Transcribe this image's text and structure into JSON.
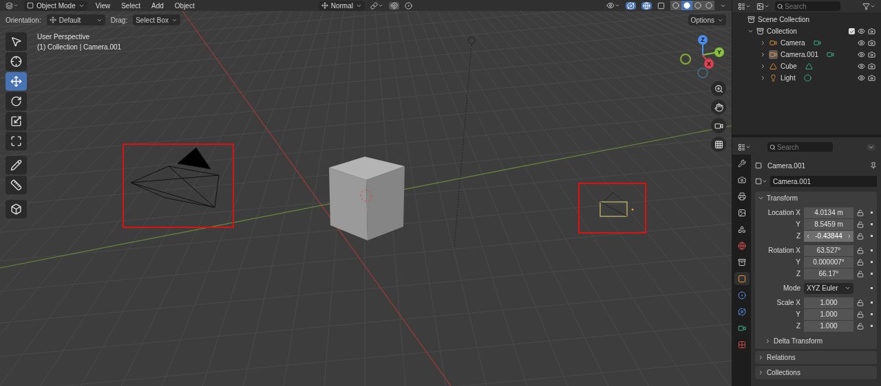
{
  "header": {
    "mode": "Object Mode",
    "menus": [
      "View",
      "Select",
      "Add",
      "Object"
    ],
    "orientation": "Normal",
    "shading": [
      {
        "kind": "wireframe",
        "selected": false
      },
      {
        "kind": "solid",
        "selected": true
      },
      {
        "kind": "material",
        "selected": false
      },
      {
        "kind": "rendered",
        "selected": false
      }
    ]
  },
  "tool_settings": {
    "orientation_label": "Orientation:",
    "orientation": "Default",
    "drag_label": "Drag:",
    "drag": "Select Box",
    "options": "Options"
  },
  "viewport": {
    "view_name": "User Perspective",
    "context": "(1) Collection | Camera.001",
    "gizmo_axes": [
      "Z",
      "Y",
      "X"
    ]
  },
  "toolbar": [
    {
      "kind": "select_box",
      "selected": false
    },
    {
      "kind": "cursor",
      "selected": false
    },
    {
      "kind": "move",
      "selected": true
    },
    {
      "kind": "rotate",
      "selected": false
    },
    {
      "kind": "scale",
      "selected": false
    },
    {
      "kind": "transform",
      "selected": false
    },
    {
      "kind": "annotate",
      "selected": false
    },
    {
      "kind": "measure",
      "selected": false
    },
    {
      "kind": "add_cube",
      "selected": false
    }
  ],
  "outliner": {
    "search_placeholder": "Search",
    "root": "Scene Collection",
    "collection": {
      "name": "Collection",
      "checked": true,
      "expanded": true,
      "children": [
        {
          "name": "Camera",
          "kind": "camera",
          "selected": false
        },
        {
          "name": "Camera.001",
          "kind": "camera",
          "selected": true
        },
        {
          "name": "Cube",
          "kind": "mesh",
          "selected": false
        },
        {
          "name": "Light",
          "kind": "light",
          "selected": false
        }
      ]
    }
  },
  "properties": {
    "search_placeholder": "Search",
    "tabs": [
      {
        "kind": "tool",
        "selected": false
      },
      {
        "kind": "render",
        "selected": false
      },
      {
        "kind": "output",
        "selected": false
      },
      {
        "kind": "view_layer",
        "selected": false
      },
      {
        "kind": "scene",
        "selected": false
      },
      {
        "kind": "world",
        "selected": false
      },
      {
        "kind": "collection",
        "selected": false
      },
      {
        "kind": "object",
        "selected": true
      },
      {
        "kind": "modifiers",
        "selected": false
      },
      {
        "kind": "physics",
        "selected": false
      },
      {
        "kind": "object_data",
        "selected": false
      },
      {
        "kind": "texture",
        "selected": false
      }
    ],
    "object_name": "Camera.001",
    "datablock": "Camera.001",
    "transform": {
      "title": "Transform",
      "expanded": true,
      "rows": [
        {
          "label": "Location X",
          "value": "4.0134 m",
          "kind": "number"
        },
        {
          "label": "Y",
          "value": "8.5459 m",
          "kind": "number"
        },
        {
          "label": "Z",
          "value": "-0.43844",
          "kind": "number_hovered"
        },
        {
          "label": "Rotation X",
          "value": "63.527°",
          "kind": "number"
        },
        {
          "label": "Y",
          "value": "0.000007°",
          "kind": "number"
        },
        {
          "label": "Z",
          "value": "66.17°",
          "kind": "number"
        },
        {
          "label": "Mode",
          "value": "XYZ Euler",
          "kind": "dropdown"
        },
        {
          "label": "Scale X",
          "value": "1.000",
          "kind": "number"
        },
        {
          "label": "Y",
          "value": "1.000",
          "kind": "number"
        },
        {
          "label": "Z",
          "value": "1.000",
          "kind": "number"
        }
      ],
      "subpanel": {
        "title": "Delta Transform",
        "expanded": false
      }
    },
    "panels": [
      {
        "title": "Relations",
        "expanded": false
      },
      {
        "title": "Collections",
        "expanded": false
      }
    ]
  }
}
